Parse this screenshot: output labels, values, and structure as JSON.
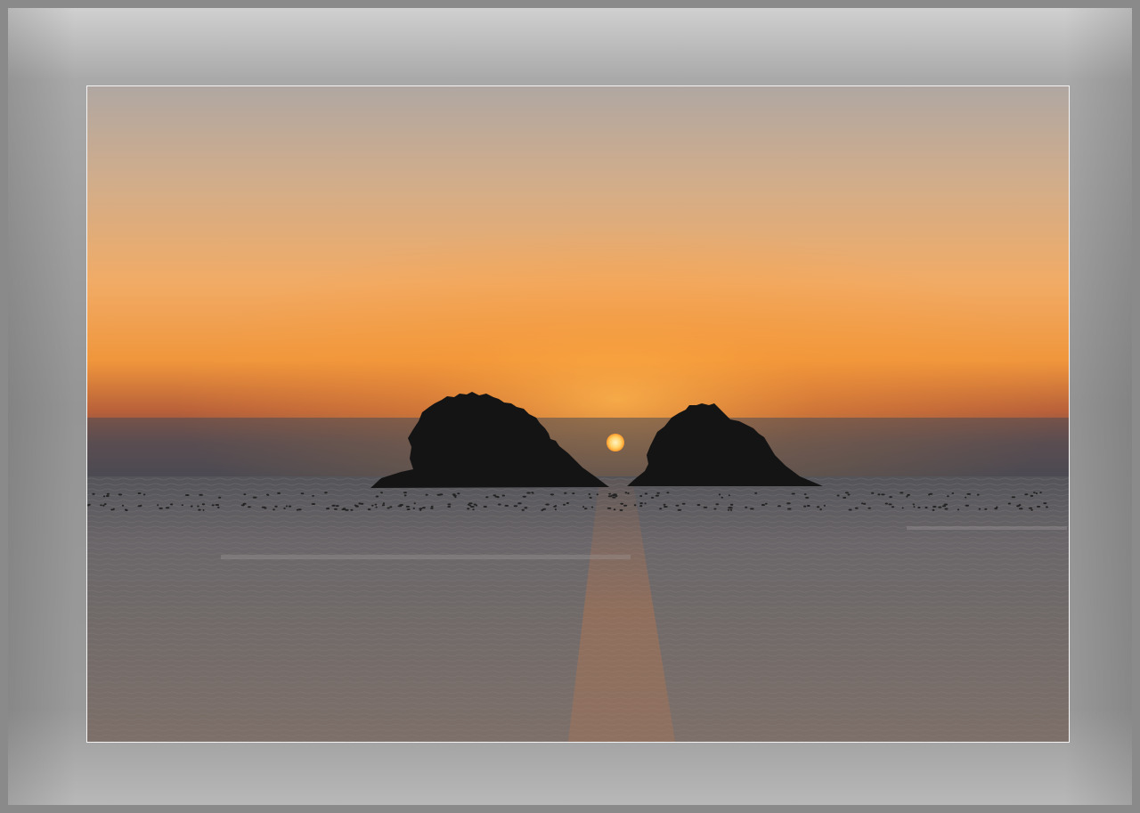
{
  "scene": {
    "subject": "sunset-over-sea-with-two-islands",
    "colors": {
      "sky_top": "#b0a69f",
      "sky_mid": "#f3ad65",
      "sky_glow": "#f59a2a",
      "haze": "#4e4a52",
      "sun": "#ffd36b",
      "sea": "#6f6b6c",
      "island": "#151515",
      "frame": "#959595"
    }
  }
}
